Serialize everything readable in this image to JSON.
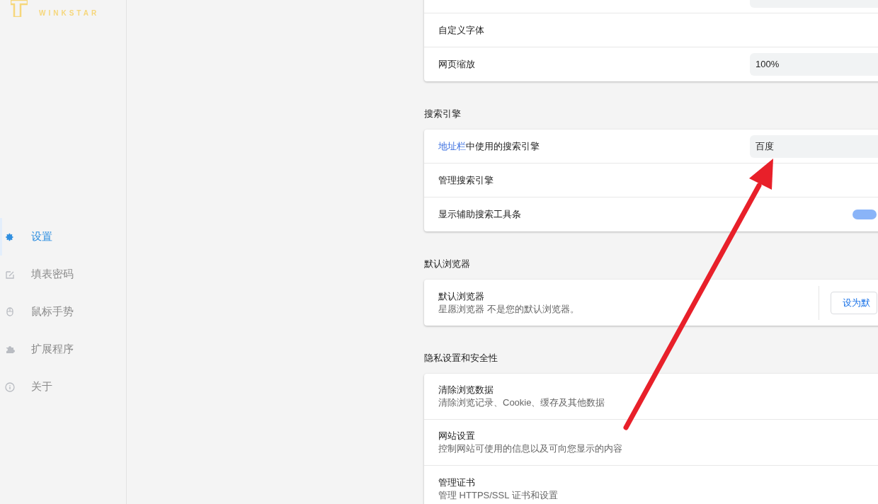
{
  "sidebar": {
    "logo_text": "WINKSTAR",
    "items": [
      {
        "label": "设置",
        "selected": true
      },
      {
        "label": "填表密码",
        "selected": false
      },
      {
        "label": "鼠标手势",
        "selected": false
      },
      {
        "label": "扩展程序",
        "selected": false
      },
      {
        "label": "关于",
        "selected": false
      }
    ]
  },
  "sections": [
    {
      "rows": [
        {
          "kind": "select",
          "label": ""
        },
        {
          "kind": "plain",
          "label": "自定义字体"
        },
        {
          "kind": "select",
          "label": "网页缩放",
          "value": "100%"
        }
      ]
    },
    {
      "title": "搜索引擎",
      "rows": [
        {
          "kind": "select",
          "label": "中使用的搜索引擎",
          "link": "地址栏",
          "value": "百度"
        },
        {
          "kind": "plain",
          "label": "管理搜索引擎"
        },
        {
          "kind": "toggle",
          "label": "显示辅助搜索工具条",
          "on": true
        }
      ]
    },
    {
      "title": "默认浏览器",
      "rows": [
        {
          "kind": "button",
          "label": "默认浏览器",
          "description": "星愿浏览器 不是您的默认浏览器。",
          "button": "设为默"
        }
      ]
    },
    {
      "title": "隐私设置和安全性",
      "rows": [
        {
          "kind": "plain",
          "label": "清除浏览数据",
          "description": "清除浏览记录、Cookie、缓存及其他数据"
        },
        {
          "kind": "plain",
          "label": "网站设置",
          "description": "控制网站可使用的信息以及可向您显示的内容"
        },
        {
          "kind": "plain",
          "label": "管理证书",
          "description": "管理 HTTPS/SSL 证书和设置"
        }
      ]
    }
  ]
}
